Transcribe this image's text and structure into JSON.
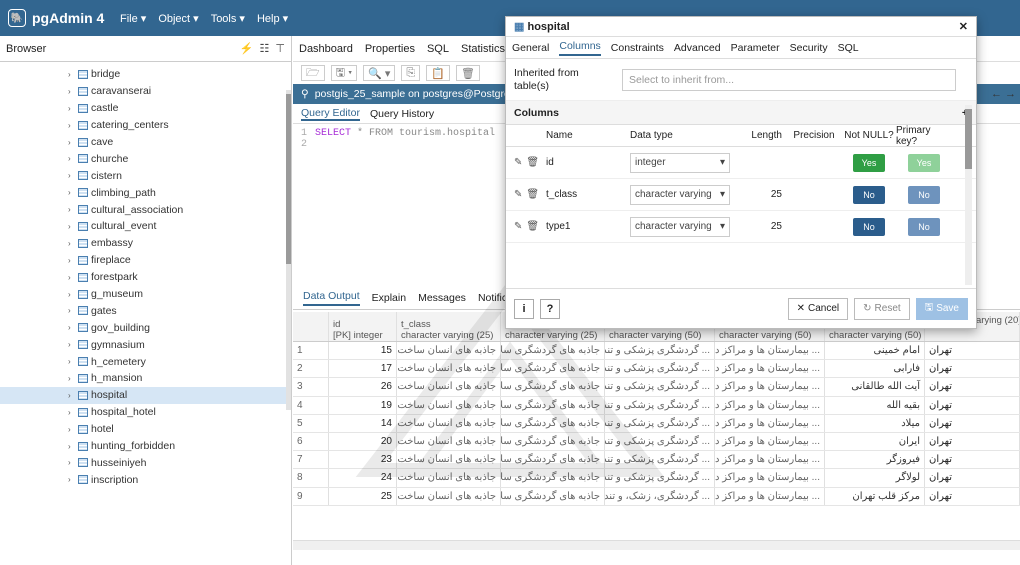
{
  "app": {
    "name": "pgAdmin 4",
    "menu": [
      "File ▾",
      "Object ▾",
      "Tools ▾",
      "Help ▾"
    ]
  },
  "browser": {
    "title": "Browser",
    "items": [
      {
        "label": "bridge"
      },
      {
        "label": "caravanserai"
      },
      {
        "label": "castle"
      },
      {
        "label": "catering_centers"
      },
      {
        "label": "cave"
      },
      {
        "label": "churche"
      },
      {
        "label": "cistern"
      },
      {
        "label": "climbing_path"
      },
      {
        "label": "cultural_association"
      },
      {
        "label": "cultural_event"
      },
      {
        "label": "embassy"
      },
      {
        "label": "fireplace"
      },
      {
        "label": "forestpark"
      },
      {
        "label": "g_museum"
      },
      {
        "label": "gates"
      },
      {
        "label": "gov_building"
      },
      {
        "label": "gymnasium"
      },
      {
        "label": "h_cemetery"
      },
      {
        "label": "h_mansion"
      },
      {
        "label": "hospital",
        "selected": true
      },
      {
        "label": "hospital_hotel"
      },
      {
        "label": "hotel"
      },
      {
        "label": "hunting_forbidden"
      },
      {
        "label": "husseiniyeh"
      },
      {
        "label": "inscription"
      }
    ]
  },
  "main": {
    "tabs": [
      "Dashboard",
      "Properties",
      "SQL",
      "Statistics"
    ],
    "connection": "postgis_25_sample on postgres@Postgre",
    "query_tabs": [
      "Query Editor",
      "Query History"
    ],
    "editor_lines": [
      {
        "num": "1",
        "keyword": "SELECT",
        "rest": " * FROM tourism.hospital"
      },
      {
        "num": "2",
        "keyword": "",
        "rest": ""
      }
    ],
    "data_tabs": [
      "Data Output",
      "Explain",
      "Messages",
      "Notifica"
    ],
    "headers": [
      {
        "name": "",
        "type": ""
      },
      {
        "name": "id",
        "type": "[PK] integer"
      },
      {
        "name": "t_class",
        "type": "character varying (25)"
      },
      {
        "name": "",
        "type": "character varying (25)"
      },
      {
        "name": "",
        "type": "character varying (50)"
      },
      {
        "name": "",
        "type": "character varying (50)"
      },
      {
        "name": "",
        "type": "character varying (50)"
      },
      {
        "name": "",
        "type": "character varying (20)"
      }
    ],
    "rows": [
      [
        "1",
        "15",
        "جاذبه های انسان ساخت",
        "جاذبه های گردشگری سلامت",
        "گردشگری پزشکی و تندرستی ...",
        "بیمارستان ها و مراکز درمانی ...",
        "امام خمینی",
        "تهران"
      ],
      [
        "2",
        "17",
        "جاذبه های انسان ساخت",
        "جاذبه های گردشگری سلامت",
        "گردشگری پزشکی و تندرستی ...",
        "بیمارستان ها و مراکز درمانی ...",
        "فارابی",
        "تهران"
      ],
      [
        "3",
        "26",
        "جاذبه های انسان ساخت",
        "جاذبه های گردشگری سلامت",
        "گردشگری پزشکی و تندرستی ...",
        "بیمارستان ها و مراکز درمانی ...",
        "آیت الله طالقانی",
        "تهران"
      ],
      [
        "4",
        "19",
        "جاذبه های انسان ساخت",
        "جاذبه های گردشگری سلامت",
        "گردشگری پزشکی و تندرستی ...",
        "بیمارستان ها و مراکز درمانی ...",
        "بقیه الله",
        "تهران"
      ],
      [
        "5",
        "14",
        "جاذبه های انسان ساخت",
        "جاذبه های گردشگری سلامت",
        "گردشگری پزشکی و تندرستی ...",
        "بیمارستان ها و مراکز درمانی ...",
        "میلاد",
        "تهران"
      ],
      [
        "6",
        "20",
        "جاذبه های انسان ساخت",
        "جاذبه های گردشگری سلامت",
        "گردشگری پزشکی و تندرستی ...",
        "بیمارستان ها و مراکز درمانی ...",
        "ایران",
        "تهران"
      ],
      [
        "7",
        "23",
        "جاذبه های انسان ساخت",
        "جاذبه های گردشگری سلامت",
        "گردشگری پزشکی و تندرستی ...",
        "بیمارستان ها و مراکز درمانی ...",
        "فیروزگر",
        "تهران"
      ],
      [
        "8",
        "24",
        "جاذبه های انسان ساخت",
        "جاذبه های گردشگری سلامت",
        "گردشگری پزشکی و تندرستی ...",
        "بیمارستان ها و مراکز درمانی ...",
        "لولاگر",
        "تهران"
      ],
      [
        "9",
        "25",
        "جاذبه های انسان ساخت",
        "جاذبه های گردشگری سلامت",
        "گردشگری، زشک، و تندرستی ...",
        "بیمارستان ها و مراکز درمانی ...",
        "مرکز قلب تهران",
        "تهران"
      ]
    ]
  },
  "dialog": {
    "title": "hospital",
    "tabs": [
      "General",
      "Columns",
      "Constraints",
      "Advanced",
      "Parameter",
      "Security",
      "SQL"
    ],
    "active_tab": "Columns",
    "inherit_label": "Inherited from table(s)",
    "inherit_placeholder": "Select to inherit from...",
    "columns_title": "Columns",
    "grid_headers": [
      "Name",
      "Data type",
      "Length",
      "Precision",
      "Not NULL?",
      "Primary key?"
    ],
    "columns": [
      {
        "name": "id",
        "type": "integer",
        "length": "",
        "precision": "",
        "not_null": "Yes",
        "pk": "Yes"
      },
      {
        "name": "t_class",
        "type": "character varying",
        "length": "25",
        "precision": "",
        "not_null": "No",
        "pk": "No"
      },
      {
        "name": "type1",
        "type": "character varying",
        "length": "25",
        "precision": "",
        "not_null": "No",
        "pk": "No"
      }
    ],
    "info_btn": "i",
    "help_btn": "?",
    "cancel": "Cancel",
    "reset": "Reset",
    "save": "Save"
  },
  "colors": {
    "brand": "#326690",
    "connection": "#3b6f95",
    "yes": "#2f9e44",
    "no": "#2b5d8c"
  }
}
